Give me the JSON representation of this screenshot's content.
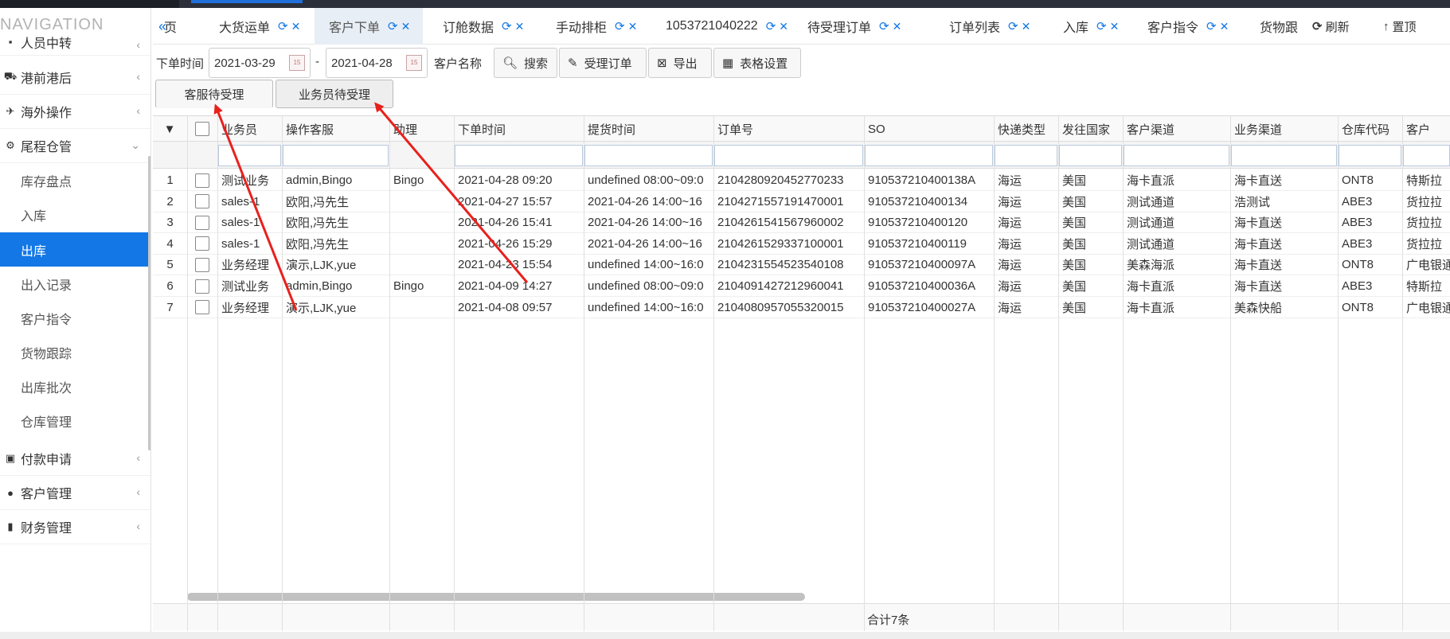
{
  "sidebar": {
    "title": "NAVIGATION",
    "items": [
      {
        "label": "人员中转",
        "icon": "menu-icon"
      },
      {
        "label": "港前港后",
        "icon": "truck-icon"
      },
      {
        "label": "海外操作",
        "icon": "plane-icon"
      },
      {
        "label": "尾程仓管",
        "icon": "gear-icon"
      },
      {
        "label": "付款申请",
        "icon": "card-icon"
      },
      {
        "label": "客户管理",
        "icon": "users-icon"
      },
      {
        "label": "财务管理",
        "icon": "money-icon"
      }
    ],
    "subitems": [
      "库存盘点",
      "入库",
      "出库",
      "出入记录",
      "客户指令",
      "货物跟踪",
      "出库批次",
      "仓库管理"
    ],
    "active_sub": "出库"
  },
  "tabs": [
    {
      "label": "页"
    },
    {
      "label": "大货运单"
    },
    {
      "label": "客户下单"
    },
    {
      "label": "订舱数据"
    },
    {
      "label": "手动排柜"
    },
    {
      "label": "1053721040222"
    },
    {
      "label": "待受理订单"
    },
    {
      "label": "订单列表"
    },
    {
      "label": "入库"
    },
    {
      "label": "客户指令"
    },
    {
      "label": "货物跟"
    }
  ],
  "tab_actions": {
    "refresh": "刷新",
    "top": "置顶"
  },
  "toolbar": {
    "order_time_label": "下单时间",
    "date_from": "2021-03-29",
    "date_sep": "-",
    "date_to": "2021-04-28",
    "customer_label": "客户名称",
    "search": "搜索",
    "accept": "受理订单",
    "export": "导出",
    "table_settings": "表格设置"
  },
  "subtabs": {
    "cs": "客服待受理",
    "sales": "业务员待受理"
  },
  "grid": {
    "headers": [
      "业务员",
      "操作客服",
      "助理",
      "下单时间",
      "提货时间",
      "订单号",
      "SO",
      "快递类型",
      "发往国家",
      "客户渠道",
      "业务渠道",
      "仓库代码",
      "客户"
    ],
    "rows": [
      [
        "1",
        "测试业务",
        "admin,Bingo",
        "Bingo",
        "2021-04-28 09:20",
        "undefined 08:00~09:0",
        "2104280920452770233",
        "910537210400138A",
        "海运",
        "美国",
        "海卡直派",
        "海卡直送",
        "ONT8",
        "特斯拉"
      ],
      [
        "2",
        "sales-1",
        "欧阳,冯先生",
        "",
        "2021-04-27 15:57",
        "2021-04-26 14:00~16",
        "2104271557191470001",
        "910537210400134",
        "海运",
        "美国",
        "测试通道",
        "浩测试",
        "ABE3",
        "货拉拉"
      ],
      [
        "3",
        "sales-1",
        "欧阳,冯先生",
        "",
        "2021-04-26 15:41",
        "2021-04-26 14:00~16",
        "2104261541567960002",
        "910537210400120",
        "海运",
        "美国",
        "测试通道",
        "海卡直送",
        "ABE3",
        "货拉拉"
      ],
      [
        "4",
        "sales-1",
        "欧阳,冯先生",
        "",
        "2021-04-26 15:29",
        "2021-04-26 14:00~16",
        "2104261529337100001",
        "910537210400119",
        "海运",
        "美国",
        "测试通道",
        "海卡直送",
        "ABE3",
        "货拉拉"
      ],
      [
        "5",
        "业务经理",
        "演示,LJK,yue",
        "",
        "2021-04-23 15:54",
        "undefined 14:00~16:0",
        "2104231554523540108",
        "910537210400097A",
        "海运",
        "美国",
        "美森海派",
        "海卡直送",
        "ONT8",
        "广电银通"
      ],
      [
        "6",
        "测试业务",
        "admin,Bingo",
        "Bingo",
        "2021-04-09 14:27",
        "undefined 08:00~09:0",
        "2104091427212960041",
        "910537210400036A",
        "海运",
        "美国",
        "海卡直派",
        "海卡直送",
        "ABE3",
        "特斯拉"
      ],
      [
        "7",
        "业务经理",
        "演示,LJK,yue",
        "",
        "2021-04-08 09:57",
        "undefined 14:00~16:0",
        "2104080957055320015",
        "910537210400027A",
        "海运",
        "美国",
        "海卡直派",
        "美森快船",
        "ONT8",
        "广电银通"
      ]
    ],
    "total": "合计7条"
  },
  "colors": {
    "accent": "#1377e6",
    "arrow": "#e8211c"
  }
}
